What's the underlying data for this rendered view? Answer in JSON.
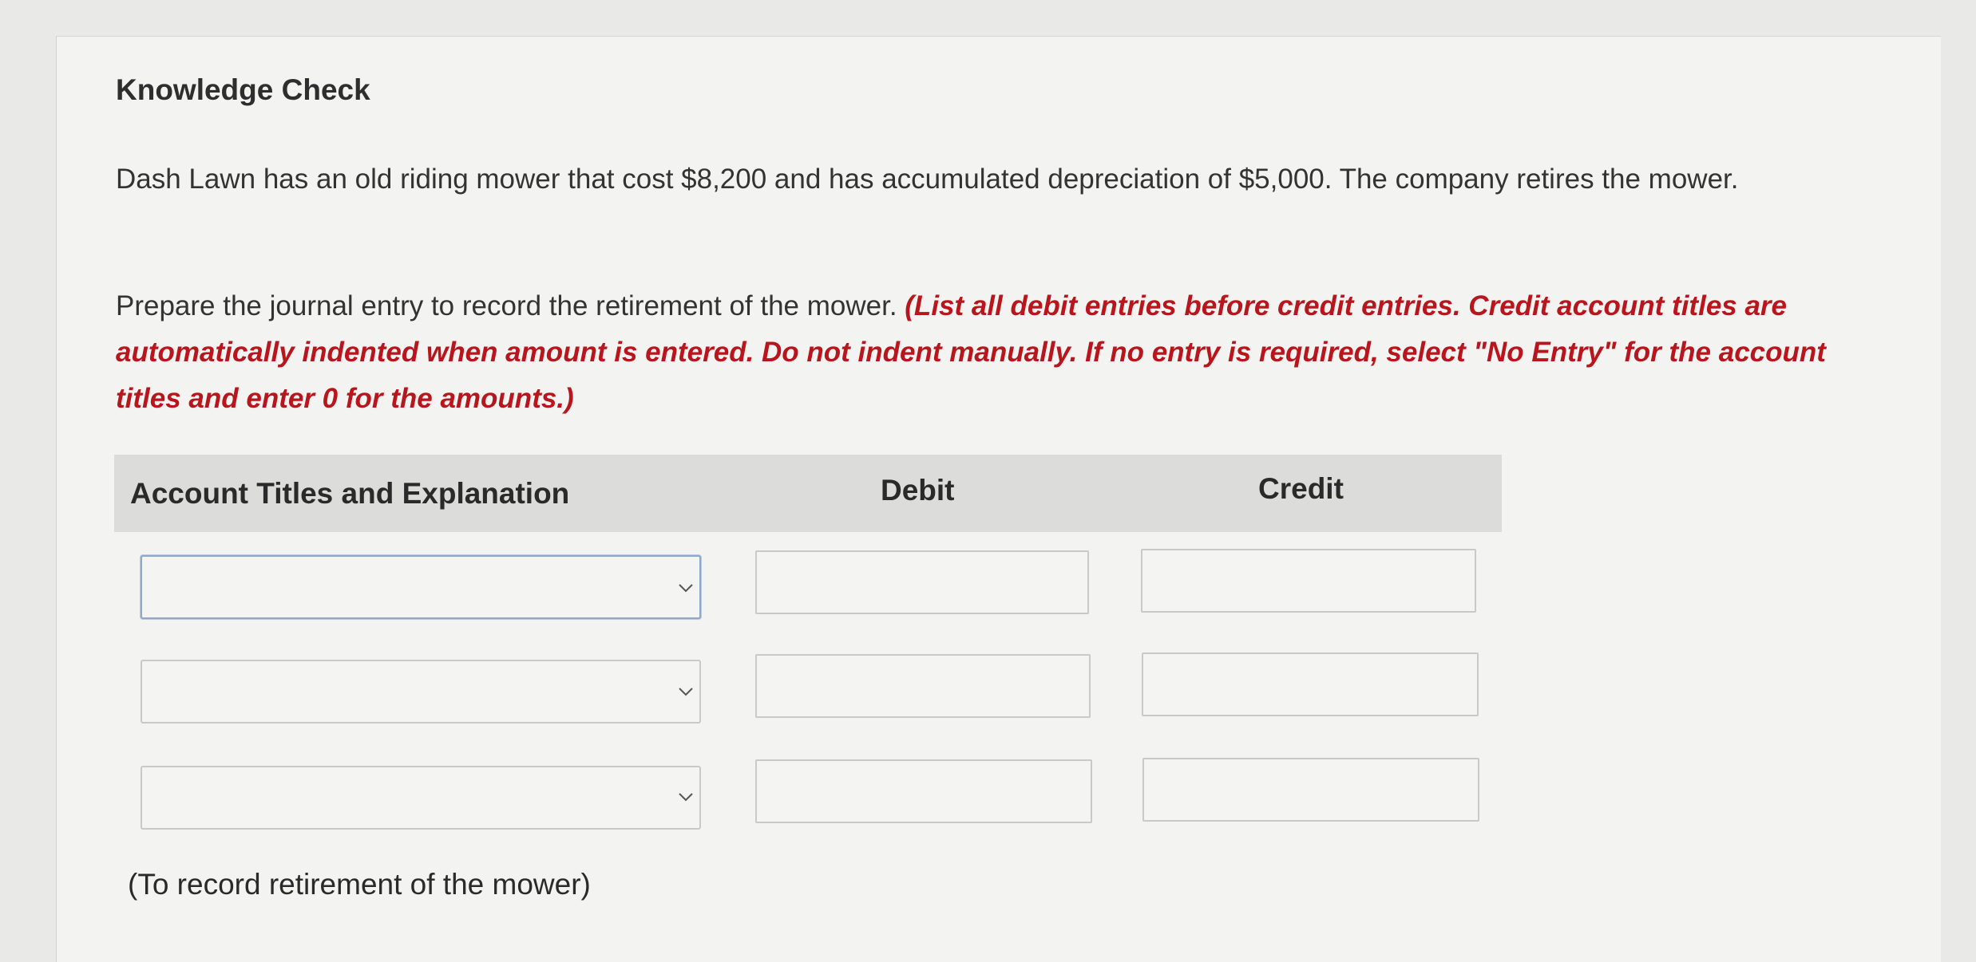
{
  "title": "Knowledge Check",
  "problem_text": "Dash Lawn has an old riding mower that cost $8,200 and has accumulated depreciation of $5,000. The company retires the mower.",
  "instruction": {
    "lead": "Prepare the journal entry to record the retirement of the mower. ",
    "note": "(List all debit entries before credit entries. Credit account titles are automatically indented when amount is entered. Do not indent manually. If no entry is required, select \"No Entry\" for the account titles and enter 0 for the amounts.)"
  },
  "table": {
    "headers": {
      "account": "Account Titles and Explanation",
      "debit": "Debit",
      "credit": "Credit"
    },
    "rows": [
      {
        "account": "",
        "debit": "",
        "credit": ""
      },
      {
        "account": "",
        "debit": "",
        "credit": ""
      },
      {
        "account": "",
        "debit": "",
        "credit": ""
      }
    ]
  },
  "explanation_note": "(To record retirement of the mower)",
  "icons": {
    "dropdown": "chevron-down-icon"
  },
  "colors": {
    "note_red": "#b8161c",
    "header_bg": "#dcdcda",
    "active_border": "#8fa7c8"
  }
}
